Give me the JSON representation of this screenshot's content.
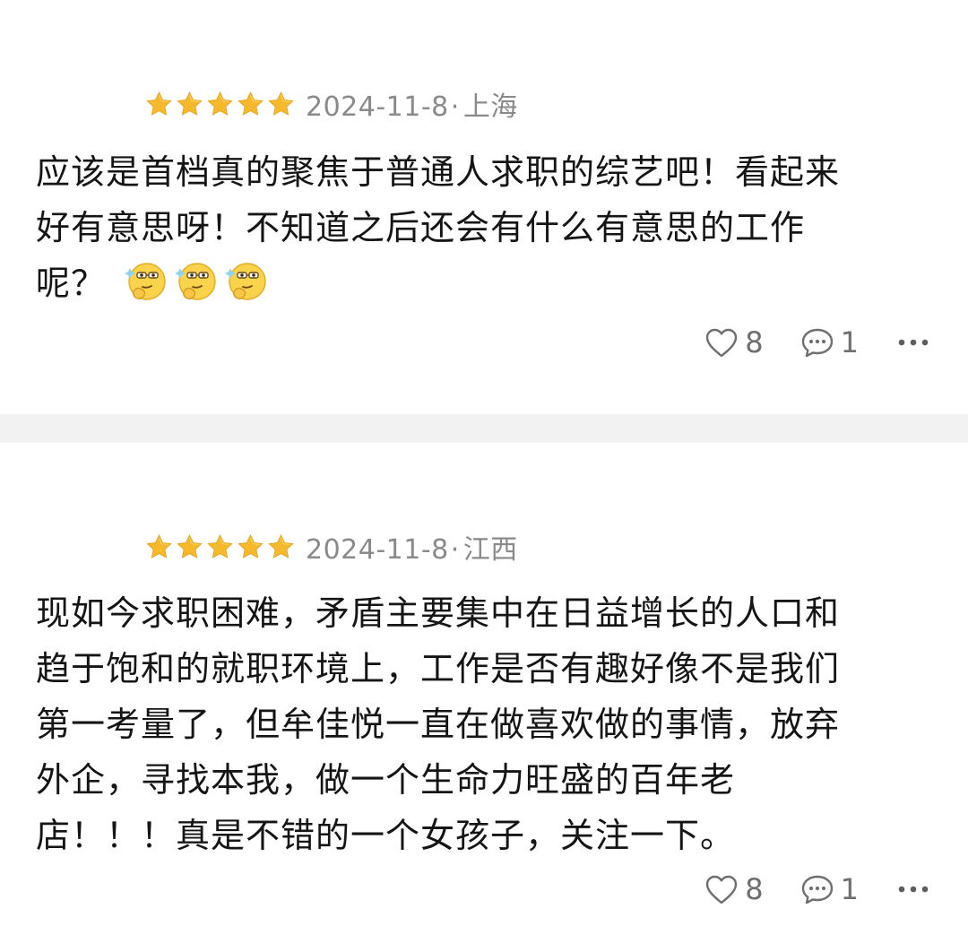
{
  "reviews": [
    {
      "rating": 5,
      "date": "2024-11-8",
      "separator": "·",
      "location": "上海",
      "lines": [
        "应该是首档真的聚焦于普通人求职的综艺吧！看起来",
        "好有意思呀！不知道之后还会有什么有意思的工作",
        "呢？"
      ],
      "emojis": [
        "thinking-glasses-emoji",
        "thinking-glasses-emoji",
        "thinking-glasses-emoji"
      ],
      "likes": "8",
      "comments": "1"
    },
    {
      "rating": 5,
      "date": "2024-11-8",
      "separator": "·",
      "location": "江西",
      "lines": [
        "现如今求职困难，矛盾主要集中在日益增长的人口和",
        "趋于饱和的就职环境上，工作是否有趣好像不是我们",
        "第一考量了，但牟佳悦一直在做喜欢做的事情，放弃",
        "外企，寻找本我，做一个生命力旺盛的百年老",
        "店！！！真是不错的一个女孩子，关注一下。"
      ],
      "likes": "8",
      "comments": "1"
    }
  ],
  "icons": {
    "star": "star-icon",
    "like": "heart-outline-icon",
    "comment": "comment-bubble-icon",
    "more": "more-dots-icon"
  },
  "colors": {
    "star": "#f5b92e",
    "meta_text": "#8a8a8a",
    "body_text": "#151515",
    "action_text": "#6f6f6f",
    "divider": "#f2f2f2"
  }
}
